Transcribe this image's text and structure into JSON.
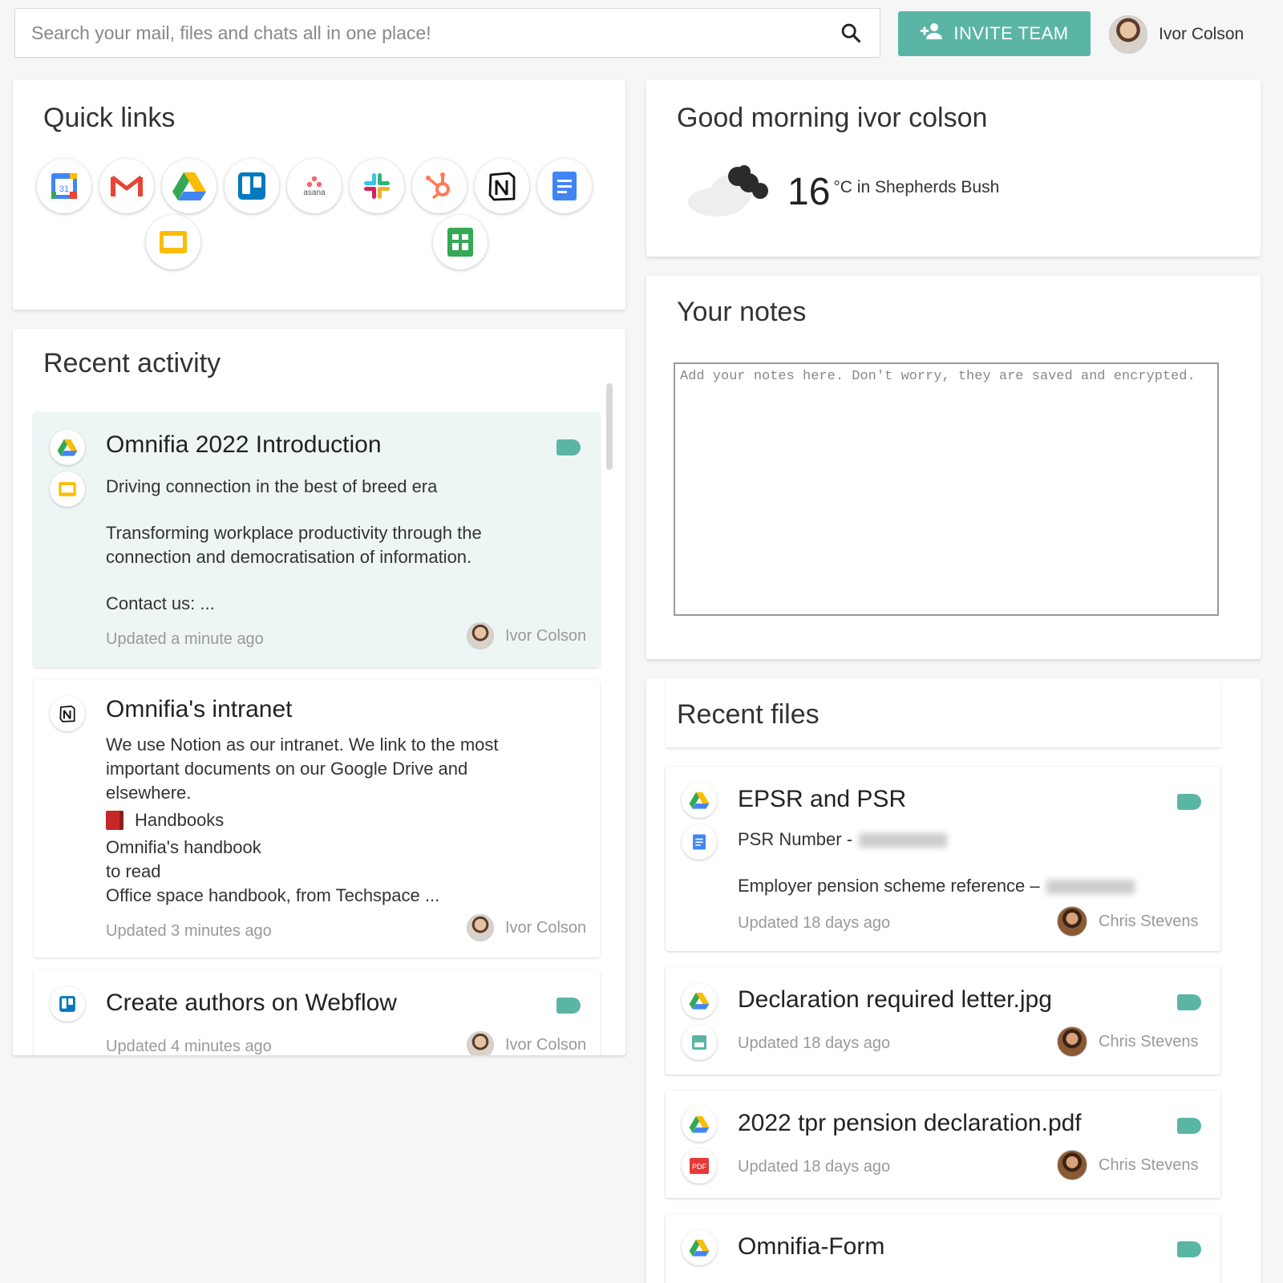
{
  "search": {
    "placeholder": "Search your mail, files and chats all in one place!"
  },
  "header": {
    "invite_label": "INVITE TEAM",
    "user_name": "Ivor Colson"
  },
  "quick_links": {
    "title": "Quick links",
    "apps": [
      "google-calendar",
      "gmail",
      "google-drive",
      "trello",
      "asana",
      "slack",
      "hubspot",
      "notion",
      "google-docs",
      "google-slides",
      "google-sheets"
    ],
    "asana_label": "asana",
    "calendar_label": "31"
  },
  "greeting": {
    "title": "Good morning ivor colson",
    "temperature": "16",
    "unit_location": "°C in Shepherds Bush"
  },
  "notes": {
    "title": "Your notes",
    "placeholder": "Add your notes here. Don't worry, they are saved and encrypted."
  },
  "recent_activity": {
    "title": "Recent activity",
    "items": [
      {
        "title": "Omnifia 2022 Introduction",
        "subtitle": "Driving connection in the best of breed era",
        "body1": "Transforming workplace productivity through the",
        "body2": "connection and democratisation of information.",
        "body3": "Contact us: ...",
        "updated": "Updated a minute ago",
        "owner": "Ivor Colson"
      },
      {
        "title": "Omnifia's intranet",
        "lines": [
          "We use Notion as our intranet. We link to the most",
          "important documents on our Google Drive and",
          "elsewhere."
        ],
        "handbooks": "Handbooks",
        "lines2": [
          "Omnifia's handbook",
          "to read",
          "Office space handbook, from Techspace ..."
        ],
        "updated": "Updated 3 minutes ago",
        "owner": "Ivor Colson"
      },
      {
        "title": "Create authors on Webflow",
        "updated": "Updated 4 minutes ago",
        "owner": "Ivor Colson"
      }
    ]
  },
  "recent_files": {
    "title": "Recent files",
    "items": [
      {
        "title": "EPSR and PSR",
        "line1": "PSR Number -",
        "line2": "Employer pension scheme reference –",
        "updated": "Updated 18 days ago",
        "owner": "Chris Stevens"
      },
      {
        "title": "Declaration required letter.jpg",
        "updated": "Updated 18 days ago",
        "owner": "Chris Stevens"
      },
      {
        "title": "2022 tpr pension declaration.pdf",
        "updated": "Updated 18 days ago",
        "owner": "Chris Stevens",
        "pdf_label": "PDF"
      },
      {
        "title": "Omnifia-Form"
      }
    ]
  },
  "colors": {
    "accent": "#5bb5a5",
    "active_bg": "#eef6f5"
  }
}
